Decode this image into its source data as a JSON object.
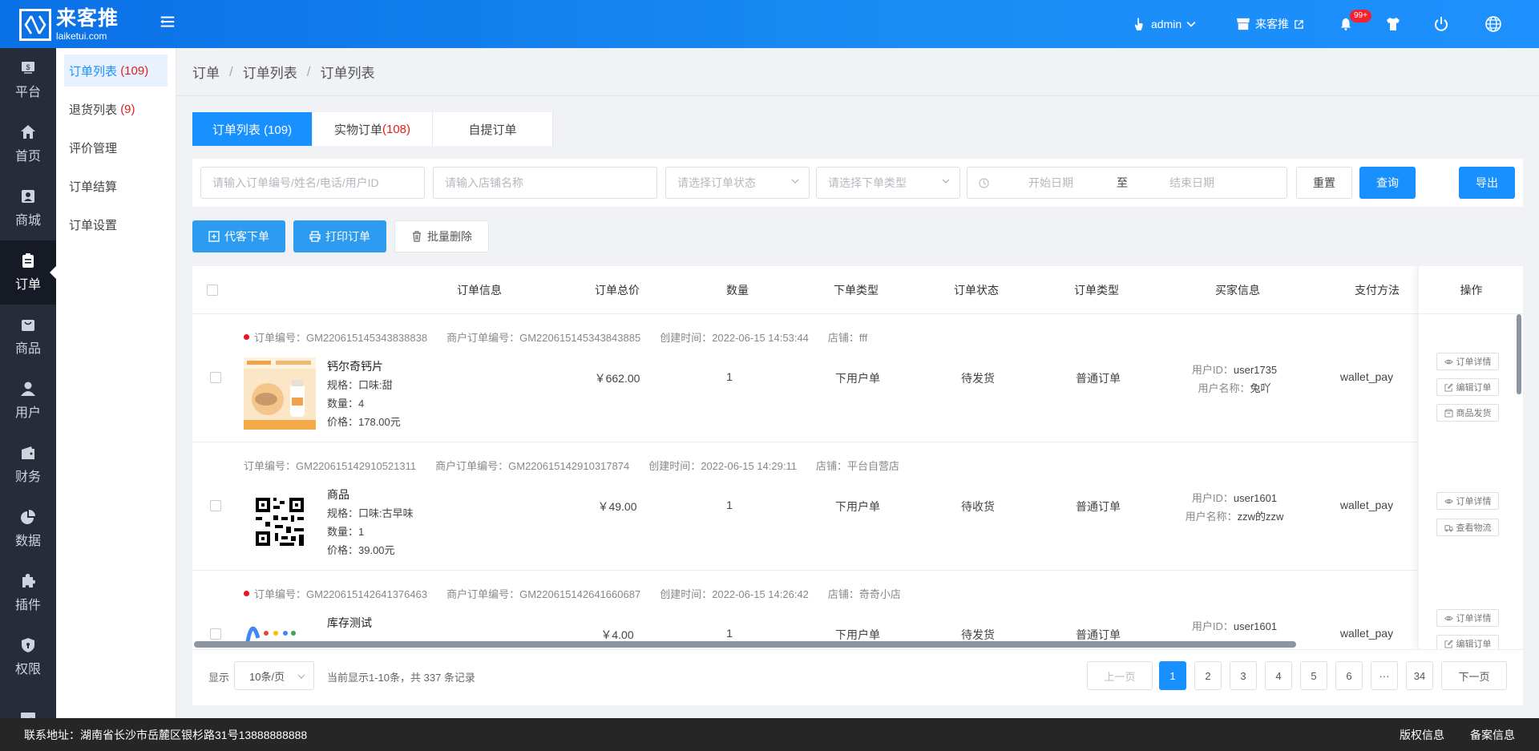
{
  "brand": {
    "name_cn": "来客推",
    "name_en": "laiketui.com"
  },
  "topbar": {
    "user": "admin",
    "store": "来客推",
    "notif_badge": "99+"
  },
  "rail": [
    {
      "label": "平台",
      "icon": "platform-icon"
    },
    {
      "label": "首页",
      "icon": "home-icon"
    },
    {
      "label": "商城",
      "icon": "mall-icon"
    },
    {
      "label": "订单",
      "icon": "order-icon",
      "active": true
    },
    {
      "label": "商品",
      "icon": "goods-icon"
    },
    {
      "label": "用户",
      "icon": "user-icon"
    },
    {
      "label": "财务",
      "icon": "wallet-icon"
    },
    {
      "label": "数据",
      "icon": "pie-chart-icon"
    },
    {
      "label": "插件",
      "icon": "puzzle-icon"
    },
    {
      "label": "权限",
      "icon": "shield-icon"
    },
    {
      "label": "",
      "icon": "image-icon"
    }
  ],
  "submenu": [
    {
      "label": "订单列表",
      "count": "(109)",
      "active": true
    },
    {
      "label": "退货列表",
      "count": "(9)"
    },
    {
      "label": "评价管理",
      "count": ""
    },
    {
      "label": "订单结算",
      "count": ""
    },
    {
      "label": "订单设置",
      "count": ""
    }
  ],
  "breadcrumb": [
    "订单",
    "订单列表",
    "订单列表"
  ],
  "tabs": [
    {
      "label": "订单列表 (109)",
      "active": true
    },
    {
      "label": "实物订单 ",
      "count": "(108)"
    },
    {
      "label": "自提订单"
    }
  ],
  "filters": {
    "order_search_placeholder": "请输入订单编号/姓名/电话/用户ID",
    "store_placeholder": "请输入店铺名称",
    "status_placeholder": "请选择订单状态",
    "type_placeholder": "请选择下单类型",
    "start_date": "开始日期",
    "date_sep": "至",
    "end_date": "结束日期",
    "reset": "重置",
    "query": "查询",
    "export": "导出"
  },
  "actions": {
    "proxy_order": "代客下单",
    "print_order": "打印订单",
    "batch_delete": "批量删除"
  },
  "columns": [
    "订单信息",
    "订单总价",
    "数量",
    "下单类型",
    "订单状态",
    "订单类型",
    "买家信息",
    "支付方法",
    "操作"
  ],
  "orders": [
    {
      "unread": true,
      "order_no": "订单编号：GM220615145343838838",
      "merchant_no": "商户订单编号：GM220615145343843885",
      "created": "创建时间：2022-06-15 14:53:44",
      "store": "店铺：fff",
      "product": "钙尔奇钙片",
      "spec": "规格：口味:甜",
      "qty_line": "数量：4",
      "price_line": "价格：178.00元",
      "total": "￥662.00",
      "qty": "1",
      "place_type": "下用户单",
      "status": "待发货",
      "order_type": "普通订单",
      "user_id": "user1735",
      "user_name": "兔吖",
      "pay": "wallet_pay",
      "ops": [
        "订单详情",
        "编辑订单",
        "商品发货"
      ]
    },
    {
      "unread": false,
      "order_no": "订单编号：GM220615142910521311",
      "merchant_no": "商户订单编号：GM220615142910317874",
      "created": "创建时间：2022-06-15 14:29:11",
      "store": "店铺：平台自营店",
      "product": "商品",
      "spec": "规格：口味:古早味",
      "qty_line": "数量：1",
      "price_line": "价格：39.00元",
      "total": "￥49.00",
      "qty": "1",
      "place_type": "下用户单",
      "status": "待收货",
      "order_type": "普通订单",
      "user_id": "user1601",
      "user_name": "zzw的zzw",
      "pay": "wallet_pay",
      "ops": [
        "订单详情",
        "查看物流"
      ]
    },
    {
      "unread": true,
      "order_no": "订单编号：GM220615142641376463",
      "merchant_no": "商户订单编号：GM220615142641660687",
      "created": "创建时间：2022-06-15 14:26:42",
      "store": "店铺：奇奇小店",
      "product": "库存测试",
      "spec": "",
      "qty_line": "",
      "price_line": "",
      "total": "￥4.00",
      "qty": "1",
      "place_type": "下用户单",
      "status": "待发货",
      "order_type": "普通订单",
      "user_id": "user1601",
      "user_name": "",
      "pay": "wallet_pay",
      "ops": [
        "订单详情",
        "编辑订单"
      ]
    }
  ],
  "buyer_labels": {
    "id": "用户ID：",
    "name": "用户名称："
  },
  "pager": {
    "show_label": "显示",
    "page_size": "10条/页",
    "summary": "当前显示1-10条，共 337 条记录",
    "prev": "上一页",
    "pages": [
      "1",
      "2",
      "3",
      "4",
      "5",
      "6",
      "···",
      "34"
    ],
    "next": "下一页"
  },
  "footer": {
    "address": "联系地址：湖南省长沙市岳麓区银杉路31号13888888888",
    "copyright": "版权信息",
    "icp": "备案信息"
  }
}
